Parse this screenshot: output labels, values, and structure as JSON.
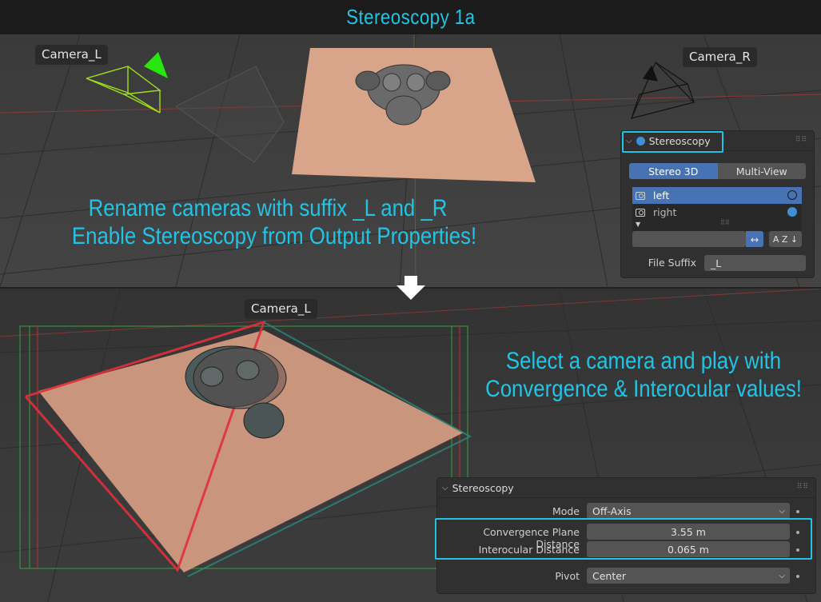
{
  "header": {
    "title": "Stereoscopy 1a"
  },
  "top_view": {
    "camera_left_label": "Camera_L",
    "camera_right_label": "Camera_R",
    "instruction_line1": "Rename cameras with suffix _L and _R",
    "instruction_line2": "Enable Stereoscopy from Output Properties!"
  },
  "output_panel": {
    "title": "Stereoscopy",
    "tabs": [
      "Stereo 3D",
      "Multi-View"
    ],
    "views": [
      {
        "name": "left",
        "selected": true
      },
      {
        "name": "right",
        "selected": false
      }
    ],
    "file_suffix_label": "File Suffix",
    "file_suffix_value": "_L",
    "swap_icon": "↔",
    "sort_icon": "A Z ↓"
  },
  "bottom_view": {
    "camera_label": "Camera_L",
    "instruction_line1": "Select a camera and play with",
    "instruction_line2": "Convergence & Interocular values!"
  },
  "camera_panel": {
    "title": "Stereoscopy",
    "rows": [
      {
        "label": "Mode",
        "value": "Off-Axis",
        "kind": "dropdown"
      },
      {
        "label": "Convergence Plane Distance",
        "value": "3.55 m",
        "kind": "number"
      },
      {
        "label": "Interocular Distance",
        "value": "0.065 m",
        "kind": "number"
      },
      {
        "label": "Pivot",
        "value": "Center",
        "kind": "dropdown"
      }
    ]
  },
  "colors": {
    "accent": "#22c4e6",
    "selection": "#4772b3",
    "panel_bg": "#303030"
  }
}
